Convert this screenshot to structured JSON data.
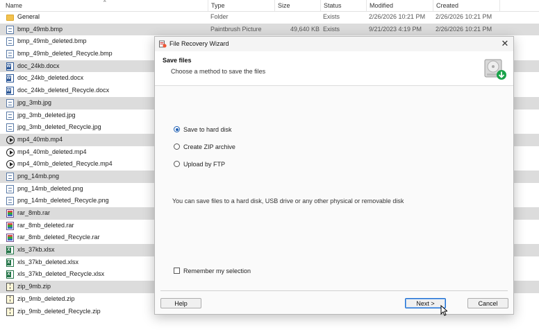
{
  "columns": {
    "name": "Name",
    "type": "Type",
    "size": "Size",
    "status": "Status",
    "modified": "Modified",
    "created": "Created"
  },
  "files": [
    {
      "name": "General",
      "icon": "folder-icon",
      "kind": "folder",
      "type": "Folder",
      "size": "",
      "status": "Exists",
      "modified": "2/26/2026 10:21 PM",
      "created": "2/26/2026 10:21 PM",
      "selected": false
    },
    {
      "name": "bmp_49mb.bmp",
      "icon": "image-file-icon",
      "kind": "file",
      "type": "Paintbrush Picture",
      "size": "49,640 KB",
      "status": "Exists",
      "modified": "9/21/2023 4:19 PM",
      "created": "2/26/2026 10:21 PM",
      "selected": true
    },
    {
      "name": "bmp_49mb_deleted.bmp",
      "icon": "image-file-icon",
      "kind": "file",
      "selected": false
    },
    {
      "name": "bmp_49mb_deleted_Recycle.bmp",
      "icon": "image-file-icon",
      "kind": "file",
      "selected": false
    },
    {
      "name": "doc_24kb.docx",
      "icon": "word-file-icon",
      "kind": "word",
      "selected": true
    },
    {
      "name": "doc_24kb_deleted.docx",
      "icon": "word-file-icon",
      "kind": "word",
      "selected": false
    },
    {
      "name": "doc_24kb_deleted_Recycle.docx",
      "icon": "word-file-icon",
      "kind": "word",
      "selected": false
    },
    {
      "name": "jpg_3mb.jpg",
      "icon": "image-file-icon",
      "kind": "file",
      "selected": true
    },
    {
      "name": "jpg_3mb_deleted.jpg",
      "icon": "image-file-icon",
      "kind": "file",
      "selected": false
    },
    {
      "name": "jpg_3mb_deleted_Recycle.jpg",
      "icon": "image-file-icon",
      "kind": "file",
      "selected": false
    },
    {
      "name": "mp4_40mb.mp4",
      "icon": "video-file-icon",
      "kind": "video",
      "selected": true
    },
    {
      "name": "mp4_40mb_deleted.mp4",
      "icon": "video-file-icon",
      "kind": "video",
      "selected": false
    },
    {
      "name": "mp4_40mb_deleted_Recycle.mp4",
      "icon": "video-file-icon",
      "kind": "video",
      "selected": false
    },
    {
      "name": "png_14mb.png",
      "icon": "image-file-icon",
      "kind": "file",
      "selected": true
    },
    {
      "name": "png_14mb_deleted.png",
      "icon": "image-file-icon",
      "kind": "file",
      "selected": false
    },
    {
      "name": "png_14mb_deleted_Recycle.png",
      "icon": "image-file-icon",
      "kind": "file",
      "selected": false
    },
    {
      "name": "rar_8mb.rar",
      "icon": "rar-archive-icon",
      "kind": "rar",
      "selected": true
    },
    {
      "name": "rar_8mb_deleted.rar",
      "icon": "rar-archive-icon",
      "kind": "rar",
      "selected": false
    },
    {
      "name": "rar_8mb_deleted_Recycle.rar",
      "icon": "rar-archive-icon",
      "kind": "rar",
      "selected": false
    },
    {
      "name": "xls_37kb.xlsx",
      "icon": "excel-file-icon",
      "kind": "xls",
      "selected": true
    },
    {
      "name": "xls_37kb_deleted.xlsx",
      "icon": "excel-file-icon",
      "kind": "xls",
      "selected": false
    },
    {
      "name": "xls_37kb_deleted_Recycle.xlsx",
      "icon": "excel-file-icon",
      "kind": "xls",
      "selected": false
    },
    {
      "name": "zip_9mb.zip",
      "icon": "zip-archive-icon",
      "kind": "zip",
      "selected": true
    },
    {
      "name": "zip_9mb_deleted.zip",
      "icon": "zip-archive-icon",
      "kind": "zip",
      "selected": false
    },
    {
      "name": "zip_9mb_deleted_Recycle.zip",
      "icon": "zip-archive-icon",
      "kind": "zip",
      "selected": false
    }
  ],
  "dialog": {
    "title": "File Recovery Wizard",
    "heading": "Save files",
    "subheading": "Choose a method to save the files",
    "options": [
      {
        "label": "Save to hard disk",
        "checked": true
      },
      {
        "label": "Create ZIP archive",
        "checked": false
      },
      {
        "label": "Upload by FTP",
        "checked": false
      }
    ],
    "info": "You can save files to a hard disk, USB drive or any other physical or removable disk",
    "remember_label": "Remember my selection",
    "remember_checked": false,
    "buttons": {
      "help": "Help",
      "next": "Next >",
      "cancel": "Cancel"
    }
  },
  "colors": {
    "selection": "#dcdcdc",
    "accent": "#1e5fb3",
    "folder": "#f3c24e",
    "recovery_arrow": "#1aa34a"
  }
}
